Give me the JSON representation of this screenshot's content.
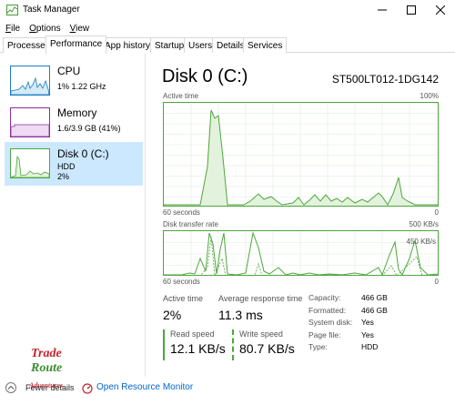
{
  "window": {
    "title": "Task Manager"
  },
  "menu": [
    {
      "first": "F",
      "rest": "ile"
    },
    {
      "first": "O",
      "rest": "ptions"
    },
    {
      "first": "V",
      "rest": "iew"
    }
  ],
  "tabs": [
    "Processes",
    "Performance",
    "App history",
    "Startup",
    "Users",
    "Details",
    "Services"
  ],
  "sidebar": {
    "cpu": {
      "title": "CPU",
      "sub": "1%  1.22 GHz",
      "color": "#1a7fc1"
    },
    "memory": {
      "title": "Memory",
      "sub": "1.6/3.9 GB (41%)",
      "color": "#8b2fa0"
    },
    "disk": {
      "title": "Disk 0 (C:)",
      "sub1": "HDD",
      "sub2": "2%",
      "color": "#4da63d"
    }
  },
  "main": {
    "title": "Disk 0 (C:)",
    "model": "ST500LT012-1DG142",
    "graph1": {
      "label_left": "Active time",
      "label_right": "100%",
      "bottom_left": "60 seconds",
      "bottom_right": "0"
    },
    "graph2": {
      "label_left": "Disk transfer rate",
      "label_right": "500 KB/s",
      "inner_label": "450 KB/s",
      "bottom_left": "60 seconds",
      "bottom_right": "0"
    },
    "stats": {
      "active_time_label": "Active time",
      "active_time_value": "2%",
      "response_label": "Average response time",
      "response_value": "11.3 ms",
      "read_label": "Read speed",
      "read_value": "12.1 KB/s",
      "write_label": "Write speed",
      "write_value": "80.7 KB/s"
    },
    "properties": [
      {
        "k": "Capacity:",
        "v": "466 GB"
      },
      {
        "k": "Formatted:",
        "v": "466 GB"
      },
      {
        "k": "System disk:",
        "v": "Yes"
      },
      {
        "k": "Page file:",
        "v": "Yes"
      },
      {
        "k": "Type:",
        "v": "HDD"
      }
    ]
  },
  "footer": {
    "fewer_details": "Fewer details",
    "open_rm": "Open Resource Monitor",
    "logo_line1": "Trade",
    "logo_line2": "Route",
    "logo_line3": "Adventures"
  },
  "colors": {
    "disk_green": "#4da63d",
    "selected_bg": "#cce8ff",
    "link": "#0066cc"
  }
}
